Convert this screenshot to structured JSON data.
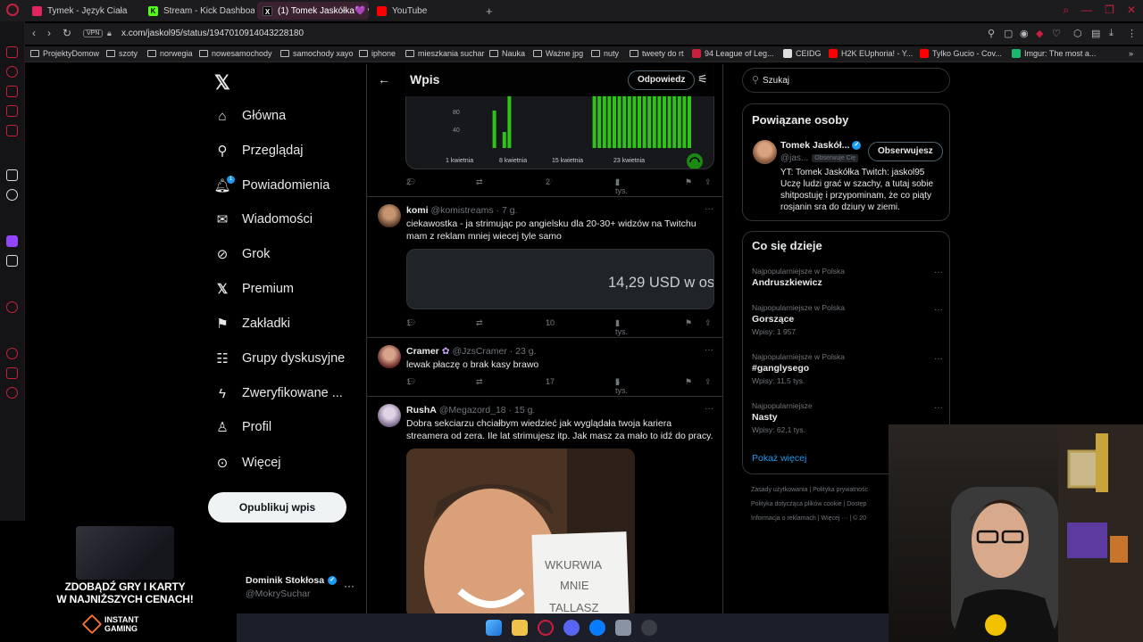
{
  "browser": {
    "tabs": [
      {
        "label": "Tymek - Język Ciała",
        "color": "#e0245e"
      },
      {
        "label": "Stream - Kick Dashboard",
        "color": "#53fc18"
      },
      {
        "label": "(1) Tomek Jaskółka💜 w",
        "color": "#ffffff"
      },
      {
        "label": "YouTube",
        "color": "#ff0000"
      }
    ],
    "url": "x.com/jaskol95/status/1947010914043228180",
    "vpn_label": "VPN",
    "bookmarks": [
      "ProjektyDomow",
      "szoty",
      "norwegia",
      "nowesamochody",
      "samochody xayo",
      "iphone",
      "mieszkania suchar",
      "Nauka",
      "Ważne jpg",
      "nuty",
      "tweety do rt",
      "94 League of Leg...",
      "CEIDG",
      "H2K EUphoria! - Y...",
      "Tylko Gucio - Cov...",
      "Imgur: The most a..."
    ]
  },
  "nav": {
    "items": [
      {
        "label": "Główna",
        "icon": "home-icon"
      },
      {
        "label": "Przeglądaj",
        "icon": "search-icon"
      },
      {
        "label": "Powiadomienia",
        "icon": "bell-icon"
      },
      {
        "label": "Wiadomości",
        "icon": "mail-icon"
      },
      {
        "label": "Grok",
        "icon": "grok-icon"
      },
      {
        "label": "Premium",
        "icon": "x-premium-icon"
      },
      {
        "label": "Zakładki",
        "icon": "bookmark-icon"
      },
      {
        "label": "Grupy dyskusyjne",
        "icon": "communities-icon"
      },
      {
        "label": "Zweryfikowane ...",
        "icon": "lightning-icon"
      },
      {
        "label": "Profil",
        "icon": "profile-icon"
      },
      {
        "label": "Więcej",
        "icon": "more-icon"
      }
    ],
    "notification_count": "1",
    "post_button": "Opublikuj wpis",
    "me": {
      "name": "Dominik Stokłosa",
      "handle": "@MokrySuchar"
    }
  },
  "promo": {
    "line1": "ZDOBĄDŹ GRY I KARTY",
    "line2": "W NAJNIŻSZYCH CENACH!",
    "brand1": "INSTANT",
    "brand2": "GAMING"
  },
  "header": {
    "title": "Wpis",
    "reply": "Odpowiedz"
  },
  "chart": {
    "y_ticks": [
      "80",
      "40"
    ],
    "x_labels": [
      "1 kwietnia",
      "8 kwietnia",
      "15 kwietnia",
      "23 kwietnia"
    ],
    "bar_color": "#2ec417"
  },
  "chart_data": {
    "type": "bar",
    "x_labels": [
      "1 kwietnia",
      "8 kwietnia",
      "15 kwietnia",
      "23 kwietnia"
    ],
    "y_ticks": [
      40,
      80
    ],
    "values": [
      0,
      0,
      0,
      0,
      0,
      0,
      0,
      0,
      0,
      0,
      70,
      0,
      30,
      100,
      0,
      0,
      0,
      0,
      0,
      0,
      0,
      0,
      0,
      0,
      0,
      0,
      0,
      0,
      0,
      0,
      100,
      100,
      100,
      100,
      100,
      100,
      100,
      100,
      100,
      100,
      100,
      100,
      100,
      100,
      100,
      100,
      100,
      100,
      100,
      100
    ]
  },
  "main_tweet_actions": {
    "replies": "2",
    "likes": "2",
    "views": "2 tys."
  },
  "tweets": [
    {
      "name": "komi",
      "handle": "@komistreams",
      "time": "7 g.",
      "text": "ciekawostka - ja strimując po angielsku dla 20-30+ widzów na Twitchu mam z reklam mniej wiecej tyle samo",
      "card": "14,29 USD w os",
      "replies": "1",
      "likes": "10",
      "views": "1 tys."
    },
    {
      "name": "Cramer",
      "handle": "@JzsCramer",
      "time": "23 g.",
      "text": "lewak płaczę o brak kasy brawo",
      "replies": "1",
      "likes": "17",
      "views": "5 tys."
    },
    {
      "name": "RushA",
      "handle": "@Megazord_18",
      "time": "15 g.",
      "text": "Dobra sekciarzu chciałbym wiedzieć jak wyglądała twoja kariera streamera od zera. Ile lat strimujesz itp. Jak masz za mało to idź do pracy.",
      "photo_sign": [
        "WKURWIA",
        "MNIE",
        "TALLASZ"
      ]
    }
  ],
  "right": {
    "search_placeholder": "Szukaj",
    "related_title": "Powiązane osoby",
    "related": {
      "name": "Tomek Jaskół...",
      "handle": "@jas...",
      "follows_you": "Obserwuje Cię",
      "follow": "Obserwujesz",
      "bio": "YT: Tomek Jaskółka Twitch: jaskol95 Uczę ludzi grać w szachy, a tutaj sobie shitpostuję i przypominam, że co piąty rosjanin sra do dziury w ziemi."
    },
    "trends_title": "Co się dzieje",
    "trends": [
      {
        "ctx": "Najpopularniejsze w Polska",
        "title": "Andruszkiewicz",
        "count": ""
      },
      {
        "ctx": "Najpopularniejsze w Polska",
        "title": "Gorszące",
        "count": "Wpisy: 1 957"
      },
      {
        "ctx": "Najpopularniejsze w Polska",
        "title": "#ganglysego",
        "count": "Wpisy: 11,5 tys."
      },
      {
        "ctx": "Najpopularniejsze",
        "title": "Nasty",
        "count": "Wpisy: 62,1 tys."
      }
    ],
    "show_more": "Pokaż więcej",
    "footer": [
      "Zasady użytkowania | Polityka prywatnośc",
      "Polityka dotycząca plików cookie | Dostęp",
      "Informacja o reklamach | Więcej ··· | © 20"
    ]
  }
}
